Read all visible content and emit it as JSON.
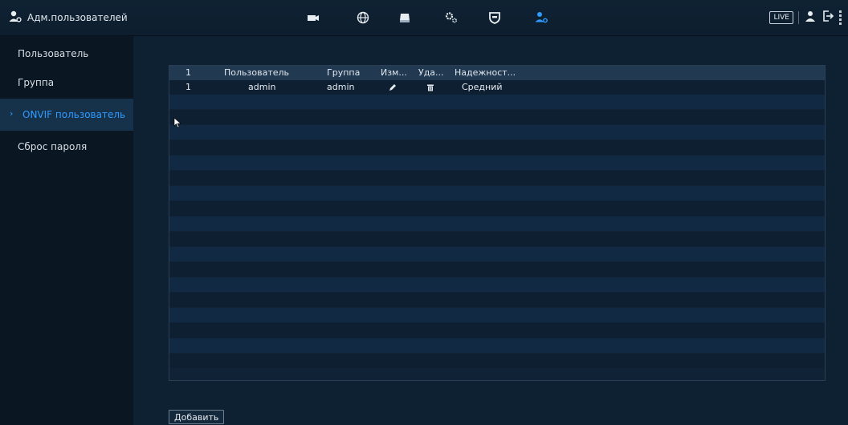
{
  "header": {
    "title": "Адм.пользователей",
    "title_icon": "user-admin-icon",
    "nav_icons": [
      "camera-icon",
      "network-globe-icon",
      "storage-icon",
      "system-settings-icon",
      "security-shield-icon",
      "user-admin-icon"
    ],
    "active_nav": "user-admin-icon",
    "live_label": "LIVE",
    "right_icons": [
      "user-icon",
      "logout-icon",
      "more-icon"
    ],
    "accent_color": "#2f9bff"
  },
  "sidebar": {
    "items": [
      {
        "label": "Пользователь",
        "active": false
      },
      {
        "label": "Группа",
        "active": false
      },
      {
        "label": "ONVIF пользователь",
        "active": true
      },
      {
        "label": "Сброс пароля",
        "active": false
      }
    ]
  },
  "table": {
    "columns": [
      "1",
      "Пользователь",
      "Группа",
      "Изм...",
      "Уда...",
      "Надежност..."
    ],
    "rows": [
      {
        "index": "1",
        "user": "admin",
        "group": "admin",
        "edit_icon": "pencil-icon",
        "delete_icon": "trash-icon",
        "strength": "Средний"
      }
    ]
  },
  "actions": {
    "add_label": "Добавить"
  }
}
